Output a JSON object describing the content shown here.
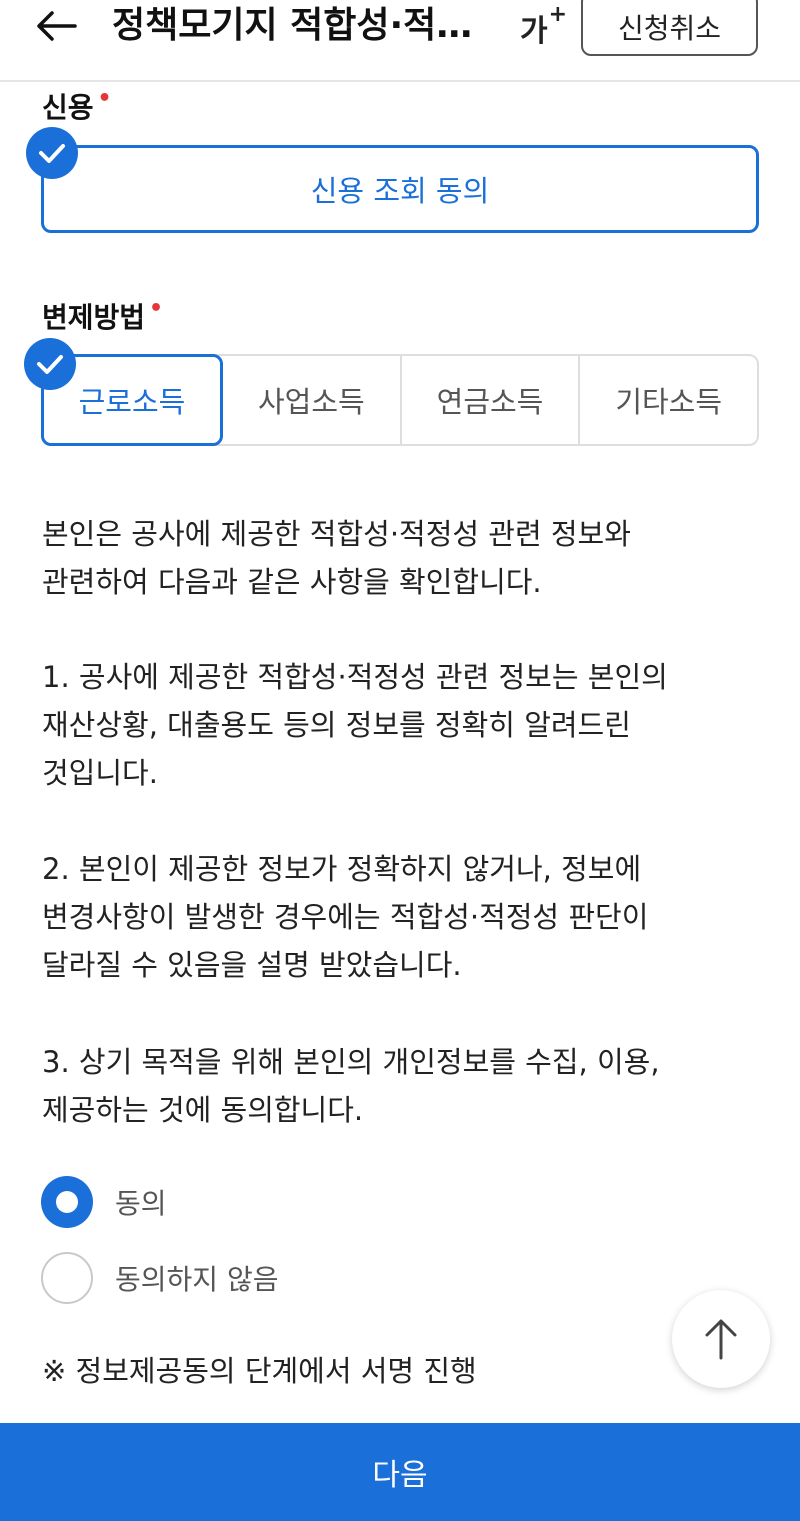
{
  "header": {
    "title": "정책모기지 적합성·적정성 확인",
    "font_size_label": "가",
    "font_size_plus": "+",
    "cancel_label": "신청취소"
  },
  "credit": {
    "label": "신용",
    "consent_label": "신용 조회 동의",
    "checked": true
  },
  "repayment": {
    "label": "변제방법",
    "options": [
      "근로소득",
      "사업소득",
      "연금소득",
      "기타소득"
    ],
    "selected": "근로소득"
  },
  "confirmation": {
    "intro": "본인은 공사에 제공한 적합성·적정성 관련 정보와\n관련하여 다음과 같은 사항을 확인합니다.",
    "item1": "1. 공사에 제공한 적합성·적정성 관련 정보는 본인의\n재산상황, 대출용도 등의 정보를 정확히 알려드린\n것입니다.",
    "item2": "2. 본인이 제공한 정보가 정확하지 않거나, 정보에\n변경사항이 발생한 경우에는 적합성·적정성 판단이\n달라질 수 있음을 설명 받았습니다.",
    "item3": "3. 상기 목적을 위해 본인의 개인정보를 수집, 이용,\n제공하는 것에 동의합니다."
  },
  "agreement": {
    "agree_label": "동의",
    "disagree_label": "동의하지 않음",
    "selected": "동의"
  },
  "note": "※ 정보제공동의 단계에서 서명 진행",
  "next_label": "다음",
  "colors": {
    "accent": "#1b6fd9",
    "required": "#e6343a"
  },
  "icons": {
    "back": "arrow-left-icon",
    "check": "check-icon",
    "scroll_top": "arrow-up-icon"
  }
}
